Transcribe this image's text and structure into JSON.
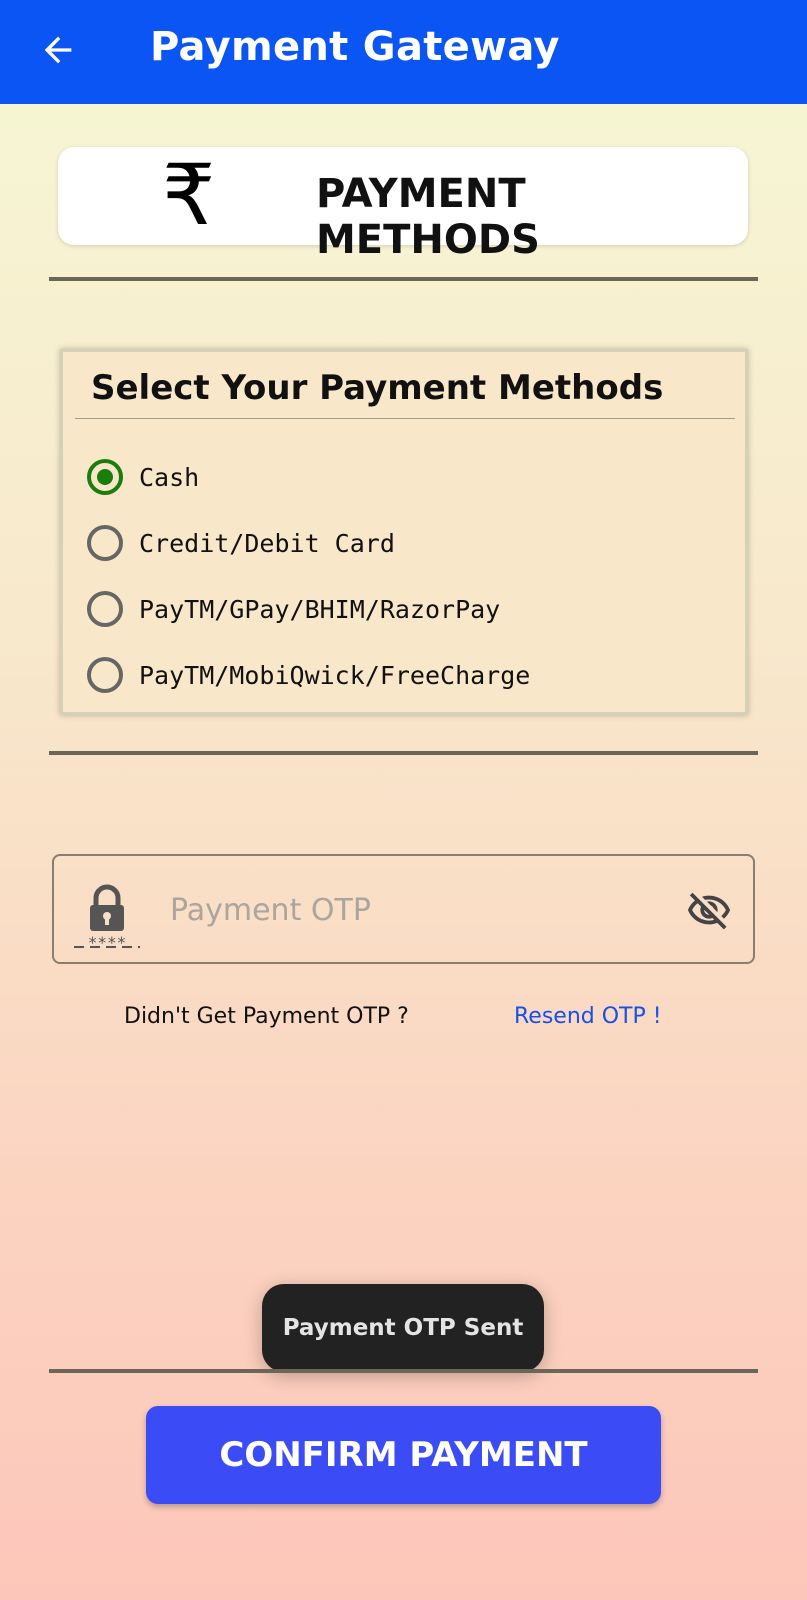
{
  "appbar": {
    "title": "Payment Gateway",
    "back_icon": "arrow-left-icon",
    "color": "#0b55f5"
  },
  "header_card": {
    "icon": "rupee-icon",
    "icon_glyph": "₹",
    "title": "PAYMENT METHODS"
  },
  "methods": {
    "title": "Select Your Payment Methods",
    "options": [
      {
        "label": "Cash",
        "selected": true
      },
      {
        "label": "Credit/Debit Card",
        "selected": false
      },
      {
        "label": "PayTM/GPay/BHIM/RazorPay",
        "selected": false
      },
      {
        "label": "PayTM/MobiQwick/FreeCharge",
        "selected": false
      }
    ],
    "selected_color": "#1b7d0c"
  },
  "otp": {
    "placeholder": "Payment OTP",
    "value": "",
    "lock_icon": "lock-icon",
    "lock_caption": "****",
    "visibility_icon": "eye-off-icon"
  },
  "otp_help": {
    "question": "Didn't Get Payment OTP ?",
    "resend_label": "Resend OTP !",
    "resend_color": "#1551e6"
  },
  "toast": {
    "message": "Payment OTP Sent"
  },
  "confirm": {
    "label": "CONFIRM PAYMENT",
    "color": "#3b4cf6"
  }
}
